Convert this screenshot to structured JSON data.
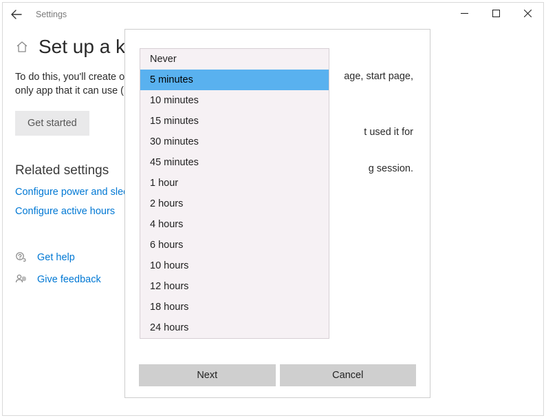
{
  "titlebar": {
    "app_title": "Settings"
  },
  "page": {
    "heading": "Set up a kiosk",
    "desc_line1": "To do this, you'll create or choose an account and then choose a home page, start page,",
    "desc_line2": "only app that it can use (",
    "get_started": "Get started",
    "related_heading": "Related settings",
    "link_power": "Configure power and sleep",
    "link_active": "Configure active hours",
    "link_help": "Get help",
    "link_feedback": "Give feedback"
  },
  "dialog": {
    "bg_line1": "age, start page,",
    "bg_line2": "t used it for",
    "bg_line3": "g session.",
    "next": "Next",
    "cancel": "Cancel"
  },
  "dropdown": {
    "selected_index": 1,
    "items": [
      "Never",
      "5 minutes",
      "10 minutes",
      "15 minutes",
      "30 minutes",
      "45 minutes",
      "1 hour",
      "2 hours",
      "4 hours",
      "6 hours",
      "10 hours",
      "12 hours",
      "18 hours",
      "24 hours"
    ]
  }
}
